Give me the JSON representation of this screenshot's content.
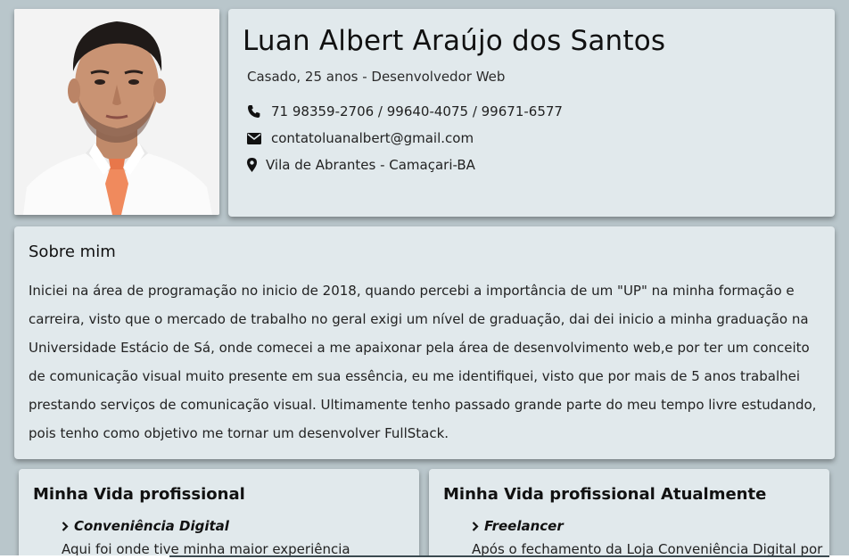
{
  "profile": {
    "name": "Luan Albert Araújo dos Santos",
    "subtitle": "Casado, 25 anos - Desenvolvedor Web",
    "phone": "71 98359-2706 / 99640-4075 / 99671-6577",
    "email": "contatoluanalbert@gmail.com",
    "location": "Vila de Abrantes - Camaçari-BA",
    "photo_alt": "profile-photo"
  },
  "icons": {
    "phone": "phone-icon",
    "email": "envelope-icon",
    "location": "map-marker-icon",
    "chevron": "chevron-right-icon"
  },
  "about": {
    "title": "Sobre mim",
    "text": "Iniciei na área de programação no inicio de 2018, quando percebi a importância de um \"UP\" na minha formação e carreira, visto que o mercado de trabalho no geral exigi um nível de graduação, dai dei inicio a minha graduação na Universidade Estácio de Sá, onde comecei a me apaixonar pela área de desenvolvimento web,e por ter um conceito de comunicação visual muito presente em sua essência, eu me identifiquei, visto que por mais de 5 anos trabalhei prestando serviços de comunicação visual. Ultimamente tenho passado grande parte do meu tempo livre estudando, pois tenho como objetivo me tornar um desenvolver FullStack."
  },
  "professional": {
    "title": "Minha Vida profissional",
    "item": "Conveniência Digital",
    "desc": "Aqui foi onde tive minha maior experiência"
  },
  "current": {
    "title": "Minha Vida profissional Atualmente",
    "item": "Freelancer",
    "desc": "Após o fechamento da Loja Conveniência Digital por"
  },
  "colors": {
    "background": "#b9c6cb",
    "card": "#e1e9ec",
    "tie": "#f08a5d"
  }
}
